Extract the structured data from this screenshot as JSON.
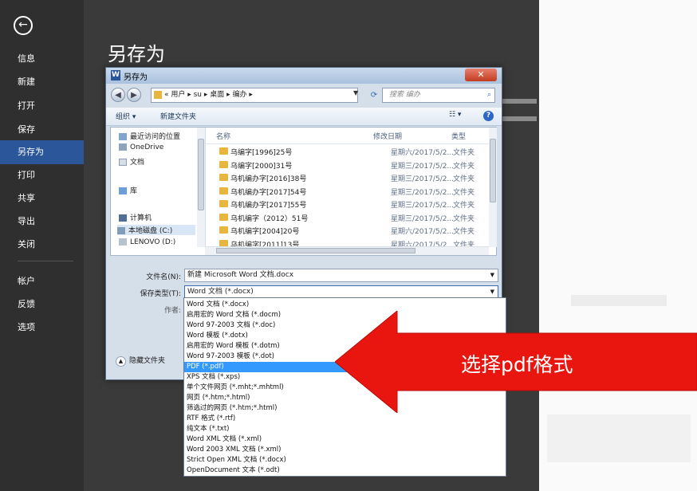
{
  "backstage": {
    "back_icon": "back-arrow-icon",
    "items": [
      {
        "label": "信息"
      },
      {
        "label": "新建"
      },
      {
        "label": "打开"
      },
      {
        "label": "保存"
      },
      {
        "label": "另存为",
        "active": true
      },
      {
        "label": "打印"
      },
      {
        "label": "共享"
      },
      {
        "label": "导出"
      },
      {
        "label": "关闭"
      },
      {
        "label": "帐户"
      },
      {
        "label": "反馈"
      },
      {
        "label": "选项"
      }
    ],
    "active_color": "#2b579a"
  },
  "page_title": "另存为",
  "dialog": {
    "title": "另存为",
    "breadcrumb": "« 用户 ▸ su ▸ 桌面 ▸ 编办 ▸",
    "search_placeholder": "搜索 编办",
    "toolbar": {
      "organize": "组织 ▾",
      "new_folder": "新建文件夹"
    },
    "nav_tree": [
      {
        "label": "最近访问的位置"
      },
      {
        "label": "OneDrive"
      },
      {
        "label": "文档"
      },
      {
        "label": "库"
      },
      {
        "label": "计算机"
      },
      {
        "label": "本地磁盘 (C:)"
      },
      {
        "label": "LENOVO (D:)"
      }
    ],
    "columns": {
      "name": "名称",
      "modified": "修改日期",
      "type": "类型"
    },
    "files": [
      {
        "name": "乌编字[1996]25号",
        "date": "星期六/2017/5/2...",
        "type": "文件夹"
      },
      {
        "name": "乌编字[2000]31号",
        "date": "星期三/2017/5/2...",
        "type": "文件夹"
      },
      {
        "name": "乌机编办字[2016]38号",
        "date": "星期三/2017/5/2...",
        "type": "文件夹"
      },
      {
        "name": "乌机编办字[2017]54号",
        "date": "星期三/2017/5/2...",
        "type": "文件夹"
      },
      {
        "name": "乌机编办字[2017]55号",
        "date": "星期三/2017/5/2...",
        "type": "文件夹"
      },
      {
        "name": "乌机编字（2012）51号",
        "date": "星期三/2017/5/2...",
        "type": "文件夹"
      },
      {
        "name": "乌机编字[2004]20号",
        "date": "星期六/2017/5/2...",
        "type": "文件夹"
      },
      {
        "name": "乌机编字[2011]13号",
        "date": "星期六/2017/5/2...",
        "type": "文件夹"
      }
    ],
    "filename_label": "文件名(N):",
    "filename_value": "新建 Microsoft Word 文档.docx",
    "filetype_label": "保存类型(T):",
    "filetype_value": "Word 文档 (*.docx)",
    "author_label": "作者:",
    "hide_folders": "隐藏文件夹"
  },
  "filetype_options": [
    {
      "label": "Word 文档 (*.docx)"
    },
    {
      "label": "启用宏的 Word 文档 (*.docm)"
    },
    {
      "label": "Word 97-2003 文档 (*.doc)"
    },
    {
      "label": "Word 模板 (*.dotx)"
    },
    {
      "label": "启用宏的 Word 模板 (*.dotm)"
    },
    {
      "label": "Word 97-2003 模板 (*.dot)"
    },
    {
      "label": "PDF (*.pdf)",
      "selected": true
    },
    {
      "label": "XPS 文档 (*.xps)"
    },
    {
      "label": "单个文件网页 (*.mht;*.mhtml)"
    },
    {
      "label": "网页 (*.htm;*.html)"
    },
    {
      "label": "筛选过的网页 (*.htm;*.html)"
    },
    {
      "label": "RTF 格式 (*.rtf)"
    },
    {
      "label": "纯文本 (*.txt)"
    },
    {
      "label": "Word XML 文档 (*.xml)"
    },
    {
      "label": "Word 2003 XML 文档 (*.xml)"
    },
    {
      "label": "Strict Open XML 文档 (*.docx)"
    },
    {
      "label": "OpenDocument 文本 (*.odt)"
    }
  ],
  "annotation": {
    "text": "选择pdf格式",
    "color": "#e8160f"
  }
}
